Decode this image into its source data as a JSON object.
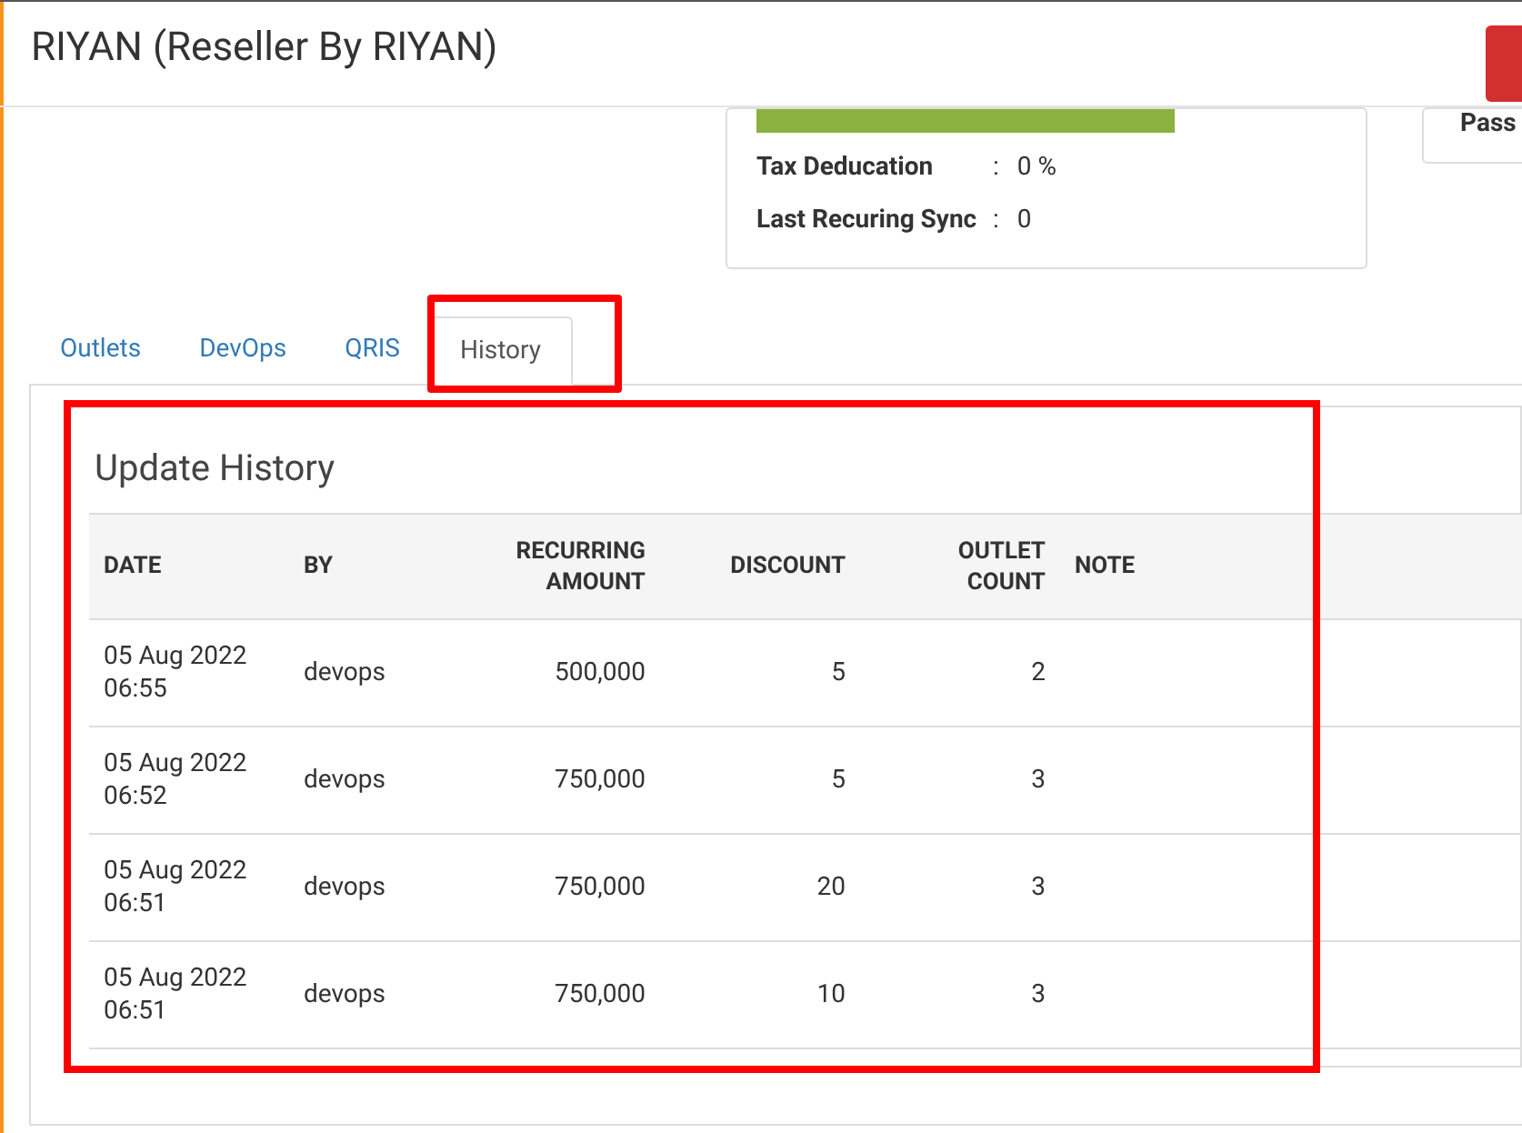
{
  "window": {
    "title": "RIYAN (Reseller By RIYAN)"
  },
  "info_card": {
    "rows": [
      {
        "label": "Tax Deducation",
        "separator": ":",
        "value": "0 %"
      },
      {
        "label": "Last Recuring Sync",
        "separator": ":",
        "value": "0"
      }
    ]
  },
  "side_card": {
    "label": "Pass"
  },
  "tabs": [
    {
      "label": "Outlets",
      "selected": false
    },
    {
      "label": "DevOps",
      "selected": false
    },
    {
      "label": "QRIS",
      "selected": false
    },
    {
      "label": "History",
      "selected": true
    }
  ],
  "history": {
    "title": "Update History",
    "columns": [
      {
        "label": "DATE",
        "kind": "text"
      },
      {
        "label": "BY",
        "kind": "text"
      },
      {
        "label": "RECURRING AMOUNT",
        "kind": "number"
      },
      {
        "label": "DISCOUNT",
        "kind": "number"
      },
      {
        "label": "OUTLET COUNT",
        "kind": "number"
      },
      {
        "label": "NOTE",
        "kind": "text"
      }
    ],
    "rows": [
      [
        "05 Aug 2022 06:55",
        "devops",
        "500,000",
        "5",
        "2",
        ""
      ],
      [
        "05 Aug 2022 06:52",
        "devops",
        "750,000",
        "5",
        "3",
        ""
      ],
      [
        "05 Aug 2022 06:51",
        "devops",
        "750,000",
        "20",
        "3",
        ""
      ],
      [
        "05 Aug 2022 06:51",
        "devops",
        "750,000",
        "10",
        "3",
        ""
      ]
    ]
  }
}
